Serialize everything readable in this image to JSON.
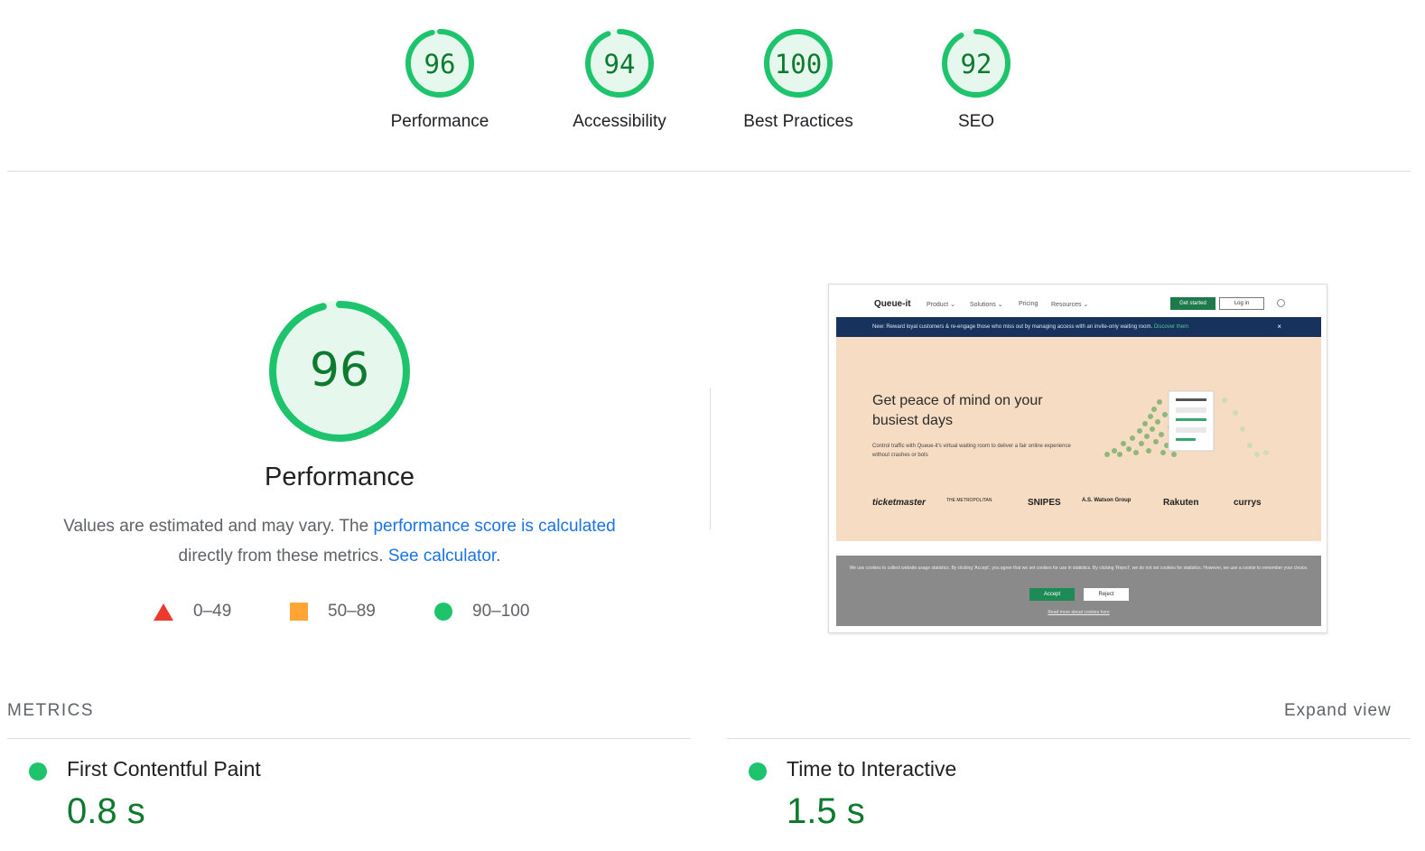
{
  "categories": [
    {
      "score": "96",
      "label": "Performance",
      "value": 0.96
    },
    {
      "score": "94",
      "label": "Accessibility",
      "value": 0.94
    },
    {
      "score": "100",
      "label": "Best Practices",
      "value": 1.0
    },
    {
      "score": "92",
      "label": "SEO",
      "value": 0.92
    }
  ],
  "performance": {
    "score": "96",
    "value": 0.96,
    "title": "Performance",
    "desc_prefix": "Values are estimated and may vary. The ",
    "desc_link1": "performance score is calculated",
    "desc_middle": "directly from these metrics. ",
    "desc_link2": "See calculator",
    "desc_suffix": "."
  },
  "legend": [
    {
      "shape": "triangle",
      "range": "0–49",
      "color": "#eb3b2e"
    },
    {
      "shape": "square",
      "range": "50–89",
      "color": "#ffa533"
    },
    {
      "shape": "circle",
      "range": "90–100",
      "color": "#1ec46b"
    }
  ],
  "thumbnail": {
    "logo": "Queue-it",
    "menu": [
      "Product ⌄",
      "Solutions ⌄",
      "Pricing",
      "Resources ⌄"
    ],
    "cta_primary": "Get started",
    "cta_secondary": "Log in",
    "banner": "New: Reward loyal customers & re-engage those who miss out by managing access with an invite-only waiting room.",
    "banner_link": "Discover them",
    "headline": "Get peace of mind on your busiest days",
    "subtext": "Control traffic with Queue-it's virtual waiting room to deliver a fair online experience without crashes or bots",
    "logos": [
      "ticketmaster",
      "THE METROPOLITAN",
      "SNIPES",
      "A.S. Watson Group",
      "Rakuten",
      "currys"
    ],
    "cookie_text": "We use cookies to collect website usage statistics. By clicking 'Accept', you agree that we set cookies for use in statistics. By clicking 'Reject', we do not set cookies for statistics. However, we use a cookie to remember your choice.",
    "accept": "Accept",
    "reject": "Reject",
    "read_more": "Read more about cookies here"
  },
  "metrics": {
    "heading": "METRICS",
    "expand": "Expand view",
    "items": [
      {
        "name": "First Contentful Paint",
        "value": "0.8 s",
        "status": "good"
      },
      {
        "name": "Time to Interactive",
        "value": "1.5 s",
        "status": "good"
      }
    ]
  },
  "colors": {
    "good": "#1ec46b",
    "good_text": "#0d7a2e",
    "good_fill": "#e6f8ee",
    "link": "#1a73e8"
  }
}
